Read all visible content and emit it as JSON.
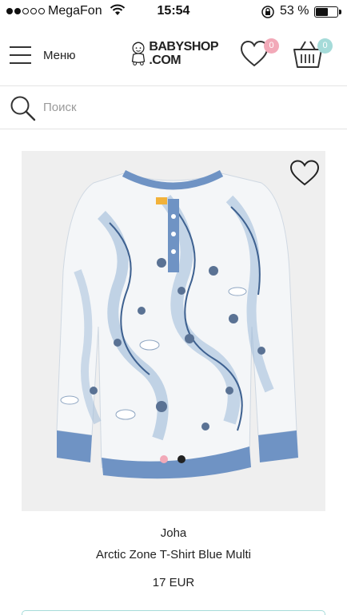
{
  "status_bar": {
    "carrier": "MegaFon",
    "time": "15:54",
    "battery_percent": "53 %",
    "signal_bars_filled": 2,
    "signal_bars_total": 5,
    "icons": [
      "signal-dots-icon",
      "wifi-icon",
      "rotation-lock-icon",
      "battery-icon"
    ]
  },
  "header": {
    "menu_label": "Меню",
    "logo_line1": "BABYSHOP",
    "logo_line2": ".COM",
    "wishlist_count": "0",
    "cart_count": "0",
    "colors": {
      "wishlist_badge": "#f2a9b8",
      "cart_badge": "#a5dbd9"
    }
  },
  "search": {
    "placeholder": "Поиск"
  },
  "product": {
    "brand": "Joha",
    "name": "Arctic Zone T-Shirt Blue Multi",
    "price": "17 EUR",
    "image_slides": 2,
    "active_slide": 2,
    "colors": {
      "dot_inactive": "#f2a9b8",
      "dot_active": "#222222",
      "shirt_trim": "#6f93c4"
    }
  }
}
